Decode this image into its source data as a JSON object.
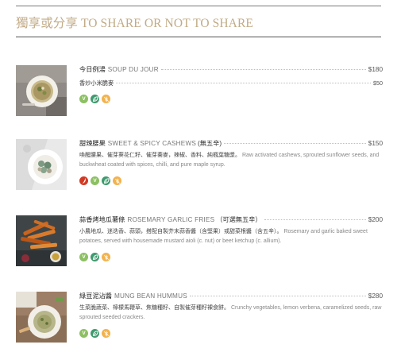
{
  "section": {
    "title": "獨享或分享 TO SHARE OR NOT TO SHARE"
  },
  "items": [
    {
      "name_zh": "今日例湯",
      "name_en": "SOUP DU JOUR",
      "extra": "",
      "price": "$180",
      "sub_zh": "香炒小米脆麥",
      "sub_price": "$50",
      "desc_zh": "",
      "desc_en": "",
      "icons": [
        "vegetarian-icon",
        "vegan-leaf-icon",
        "no-gluten-icon"
      ]
    },
    {
      "name_zh": "甜辣腰果",
      "name_en": "SWEET & SPICY CASHEWS",
      "extra": "(無五辛)",
      "price": "$150",
      "sub_zh": "",
      "sub_price": "",
      "desc_zh": "喚醒腰果、催芽葵花仁籽、催芽蕎麥，辣椒、香料、純楓葉糖漿。",
      "desc_en": "Raw activated cashews, sprouted sunflower seeds, and buckwheat coated with spices, chilli, and pure maple syrup.",
      "icons": [
        "spicy-chili-icon",
        "vegetarian-icon",
        "vegan-leaf-icon",
        "no-gluten-icon"
      ]
    },
    {
      "name_zh": "蒜香烤地瓜薯條",
      "name_en": "ROSEMARY GARLIC FRIES",
      "extra": "（可選無五辛）",
      "price": "$200",
      "sub_zh": "",
      "sub_price": "",
      "desc_zh": "小農地瓜、迷迭香、蒜頭，搭配自製芥末蒜香醬（含堅果）或甜菜根醬（含五辛）。",
      "desc_en": "Rosemary and garlic baked sweet potatoes, served with housemade mustard aioli (c. nut) or beet ketchup (c. allium).",
      "icons": [
        "vegetarian-icon",
        "vegan-leaf-icon",
        "no-gluten-icon"
      ]
    },
    {
      "name_zh": "綠豆泥沾醬",
      "name_en": "MUNG BEAN HUMMUS",
      "extra": "",
      "price": "$280",
      "sub_zh": "",
      "sub_price": "",
      "desc_zh": "生菜脆蔬菜、檸檬馬鞭草、焦糖種籽、自製催芽種籽裸食餅。",
      "desc_en": "Crunchy vegetables, lemon verbena, caramelized seeds, raw sprouted seeded crackers.",
      "icons": [
        "vegetarian-icon",
        "vegan-leaf-icon",
        "no-gluten-icon"
      ]
    }
  ],
  "colors": {
    "title": "#c2ab86",
    "spicy": "#d23a24",
    "vegetarian": "#8cc063",
    "vegan": "#3f9a6f",
    "gluten_free": "#f2b24d"
  }
}
